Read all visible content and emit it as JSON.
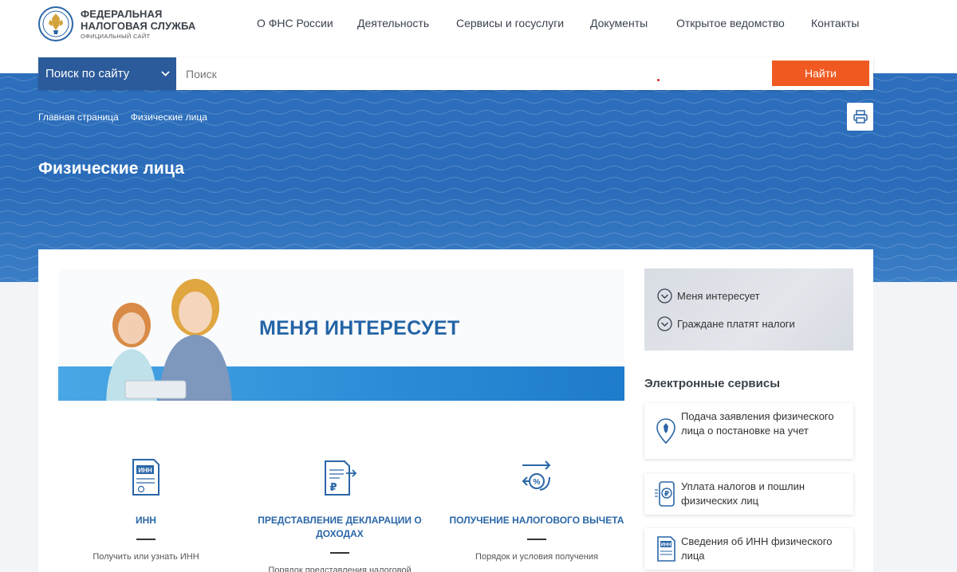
{
  "header": {
    "logo_line1": "ФЕДЕРАЛЬНАЯ",
    "logo_line2": "НАЛОГОВАЯ СЛУЖБА",
    "logo_sub": "ОФИЦИАЛЬНЫЙ САЙТ",
    "nav": [
      "О ФНС России",
      "Деятельность",
      "Сервисы и госуслуги",
      "Документы",
      "Открытое ведомство",
      "Контакты"
    ]
  },
  "search": {
    "scope": "Поиск по сайту",
    "placeholder": "Поиск",
    "button": "Найти"
  },
  "breadcrumb": [
    "Главная страница",
    "Физические лица"
  ],
  "page_title": "Физические лица",
  "banner": {
    "heading": "МЕНЯ ИНТЕРЕСУЕТ"
  },
  "features": [
    {
      "title": "ИНН",
      "desc": "Получить или узнать ИНН"
    },
    {
      "title": "ПРЕДСТАВЛЕНИЕ ДЕКЛАРАЦИИ О ДОХОДАХ",
      "desc": "Порядок представления налоговой"
    },
    {
      "title": "ПОЛУЧЕНИЕ НАЛОГОВОГО ВЫЧЕТА",
      "desc": "Порядок и условия получения"
    }
  ],
  "sidebar": {
    "interests": [
      "Меня интересует",
      "Граждане платят налоги"
    ],
    "services_title": "Электронные сервисы",
    "services": [
      "Подача заявления физического лица о постановке на учет",
      "Уплата налогов и пошлин физических лиц",
      "Сведения об ИНН физического лица"
    ]
  },
  "colors": {
    "brand_blue": "#2c5b9b",
    "accent_orange": "#f05a22",
    "link_blue": "#2a66a8"
  }
}
